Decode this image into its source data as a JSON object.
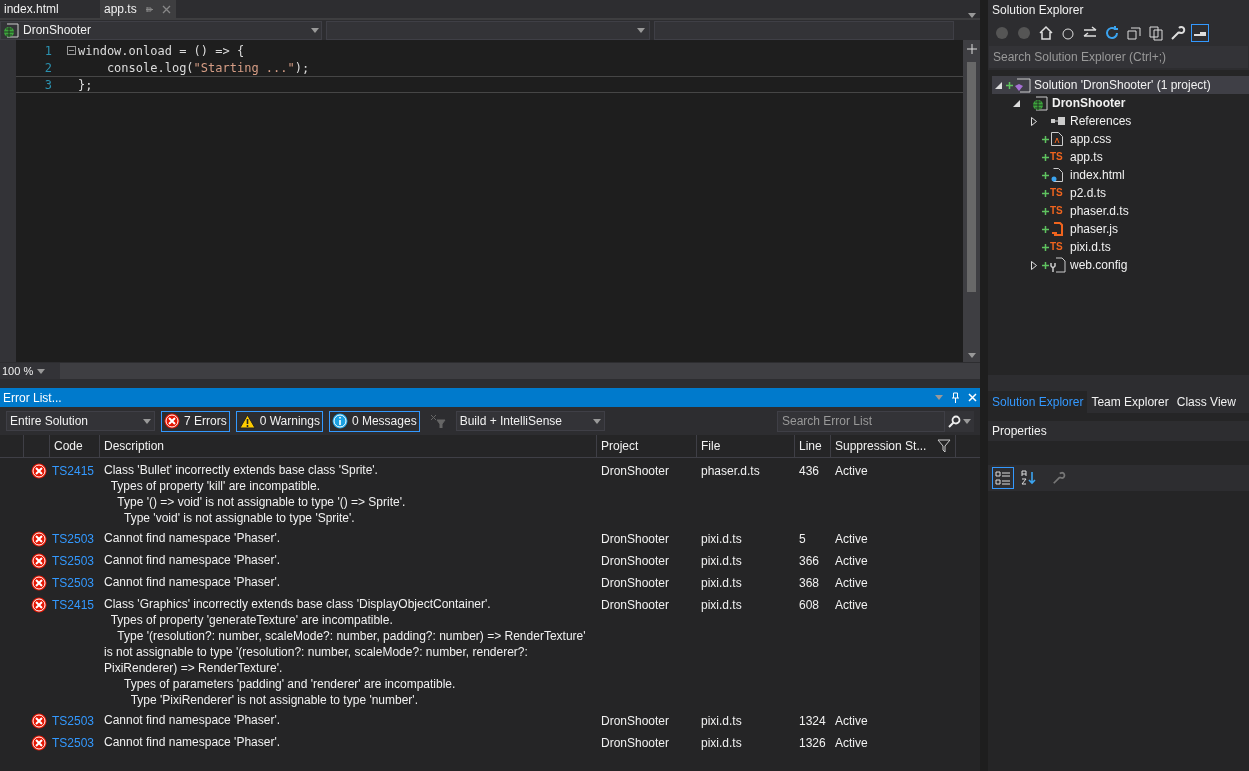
{
  "editor_tabs": [
    {
      "label": "index.html",
      "selected": false
    },
    {
      "label": "app.ts",
      "selected": true
    }
  ],
  "nav_bar": {
    "project": "DronShooter"
  },
  "code_lines": [
    {
      "number": "1",
      "tokens": [
        {
          "kind": "plain",
          "text": "window.onload = () => {"
        }
      ]
    },
    {
      "number": "2",
      "tokens": [
        {
          "kind": "plain",
          "text": "    console.log("
        },
        {
          "kind": "string",
          "text": "\"Starting ...\""
        },
        {
          "kind": "plain",
          "text": ");"
        }
      ]
    },
    {
      "number": "3",
      "tokens": [
        {
          "kind": "plain",
          "text": "};"
        }
      ]
    }
  ],
  "zoom": "100 %",
  "error_list": {
    "title": "Error List...",
    "scope": "Entire Solution",
    "errors_filter": "7 Errors",
    "warnings_filter": "0 Warnings",
    "messages_filter": "0 Messages",
    "source": "Build + IntelliSense",
    "search": {
      "placeholder": "Search Error List"
    },
    "columns": [
      "Code",
      "Description",
      "Project",
      "File",
      "Line",
      "Suppression St..."
    ],
    "rows": [
      {
        "code": "TS2415",
        "description": [
          "Class 'Bullet' incorrectly extends base class 'Sprite'.",
          "  Types of property 'kill' are incompatible.",
          "    Type '() => void' is not assignable to type '() => Sprite'.",
          "      Type 'void' is not assignable to type 'Sprite'."
        ],
        "project": "DronShooter",
        "file": "phaser.d.ts",
        "line": "436",
        "suppression": "Active"
      },
      {
        "code": "TS2503",
        "description": [
          "Cannot find namespace 'Phaser'."
        ],
        "project": "DronShooter",
        "file": "pixi.d.ts",
        "line": "5",
        "suppression": "Active"
      },
      {
        "code": "TS2503",
        "description": [
          "Cannot find namespace 'Phaser'."
        ],
        "project": "DronShooter",
        "file": "pixi.d.ts",
        "line": "366",
        "suppression": "Active"
      },
      {
        "code": "TS2503",
        "description": [
          "Cannot find namespace 'Phaser'."
        ],
        "project": "DronShooter",
        "file": "pixi.d.ts",
        "line": "368",
        "suppression": "Active"
      },
      {
        "code": "TS2415",
        "description": [
          "Class 'Graphics' incorrectly extends base class 'DisplayObjectContainer'.",
          "  Types of property 'generateTexture' are incompatible.",
          "    Type '(resolution?: number, scaleMode?: number, padding?: number) => RenderTexture' is not assignable to type '(resolution?: number, scaleMode?: number, renderer?: PixiRenderer) => RenderTexture'.",
          "      Types of parameters 'padding' and 'renderer' are incompatible.",
          "        Type 'PixiRenderer' is not assignable to type 'number'."
        ],
        "project": "DronShooter",
        "file": "pixi.d.ts",
        "line": "608",
        "suppression": "Active"
      },
      {
        "code": "TS2503",
        "description": [
          "Cannot find namespace 'Phaser'."
        ],
        "project": "DronShooter",
        "file": "pixi.d.ts",
        "line": "1324",
        "suppression": "Active"
      },
      {
        "code": "TS2503",
        "description": [
          "Cannot find namespace 'Phaser'."
        ],
        "project": "DronShooter",
        "file": "pixi.d.ts",
        "line": "1326",
        "suppression": "Active"
      }
    ]
  },
  "solution_explorer": {
    "title": "Solution Explorer",
    "search": {
      "placeholder": "Search Solution Explorer (Ctrl+;)"
    },
    "tree": [
      {
        "label": "Solution 'DronShooter' (1 project)",
        "kind": "solution",
        "added": true,
        "selected": true,
        "expanded": true,
        "children": [
          {
            "label": "DronShooter",
            "kind": "project",
            "selected": false,
            "expanded": true,
            "children": [
              {
                "label": "References",
                "kind": "references",
                "selected": false,
                "expanded": false
              },
              {
                "label": "app.css",
                "kind": "css",
                "added": true,
                "selected": false
              },
              {
                "label": "app.ts",
                "kind": "ts",
                "icon_text": "TS",
                "added": true,
                "selected": false
              },
              {
                "label": "index.html",
                "kind": "html",
                "added": true,
                "selected": false
              },
              {
                "label": "p2.d.ts",
                "kind": "ts",
                "icon_text": "TS",
                "added": true,
                "selected": false
              },
              {
                "label": "phaser.d.ts",
                "kind": "ts",
                "icon_text": "TS",
                "added": true,
                "selected": false
              },
              {
                "label": "phaser.js",
                "kind": "js",
                "added": true,
                "selected": false
              },
              {
                "label": "pixi.d.ts",
                "kind": "ts",
                "icon_text": "TS",
                "added": true,
                "selected": false
              },
              {
                "label": "web.config",
                "kind": "config",
                "added": true,
                "selected": false,
                "expanded": false
              }
            ]
          }
        ]
      }
    ]
  },
  "panel_tabs": [
    {
      "label": "Solution Explorer",
      "selected": true
    },
    {
      "label": "Team Explorer",
      "selected": false
    },
    {
      "label": "Class View",
      "selected": false
    }
  ],
  "properties": {
    "title": "Properties"
  }
}
